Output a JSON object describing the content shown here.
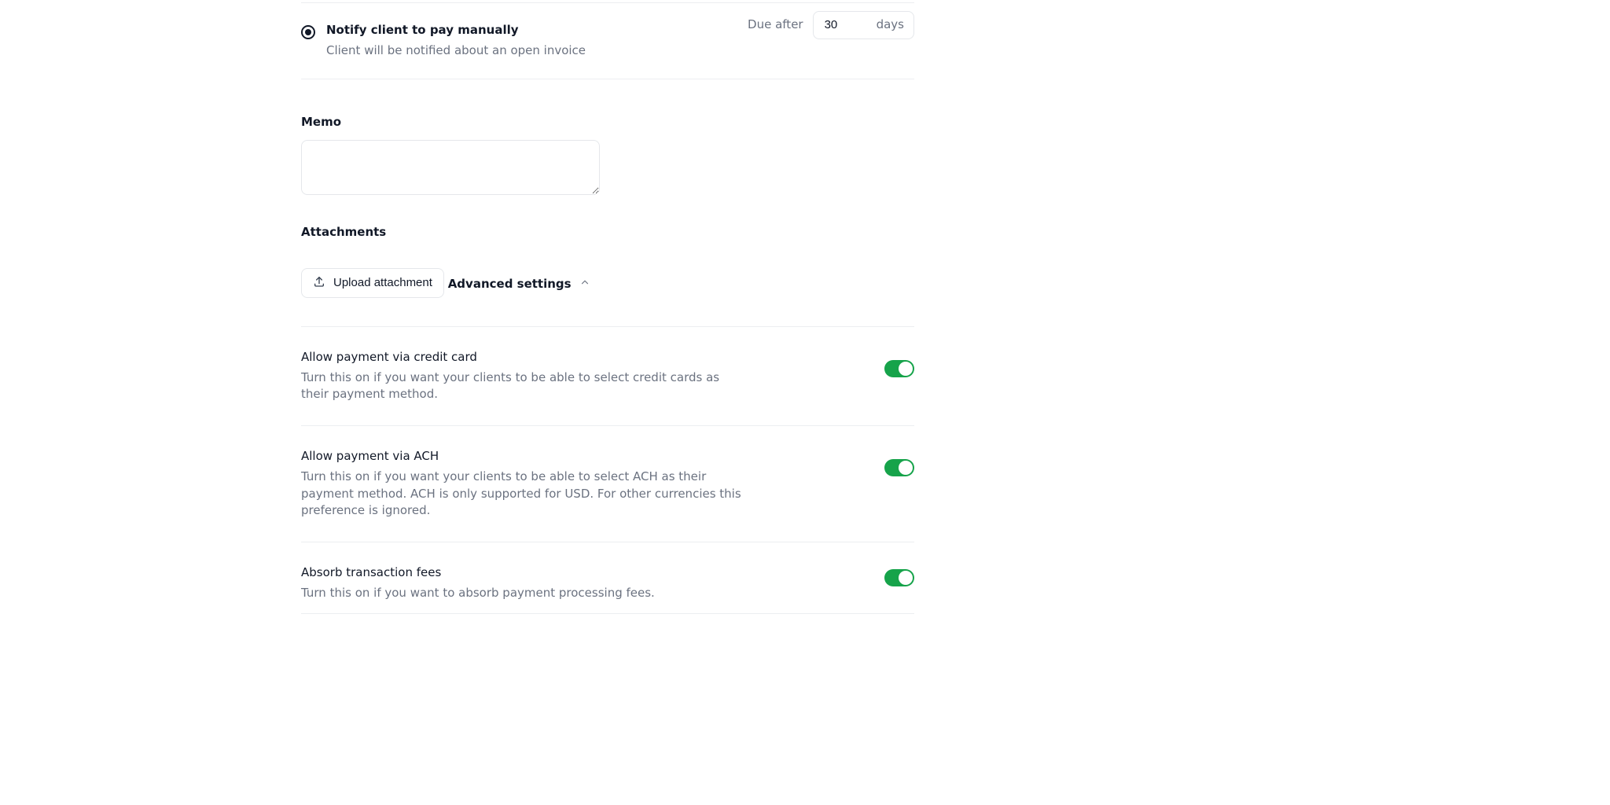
{
  "payment": {
    "notify": {
      "title": "Notify client to pay manually",
      "subtitle": "Client will be notified about an open invoice",
      "selected": true
    },
    "due": {
      "label": "Due after",
      "value": "30",
      "unit": "days"
    }
  },
  "memo": {
    "label": "Memo",
    "value": ""
  },
  "attachments": {
    "label": "Attachments",
    "upload_label": "Upload attachment"
  },
  "advanced": {
    "label": "Advanced settings",
    "settings": [
      {
        "title": "Allow payment via credit card",
        "desc": "Turn this on if you want your clients to be able to select credit cards as their payment method.",
        "on": true
      },
      {
        "title": "Allow payment via ACH",
        "desc": "Turn this on if you want your clients to be able to select ACH as their payment method. ACH is only supported for USD. For other currencies this preference is ignored.",
        "on": true
      },
      {
        "title": "Absorb transaction fees",
        "desc": "Turn this on if you want to absorb payment processing fees.",
        "on": true
      }
    ]
  },
  "colors": {
    "accent": "#16a34a"
  }
}
